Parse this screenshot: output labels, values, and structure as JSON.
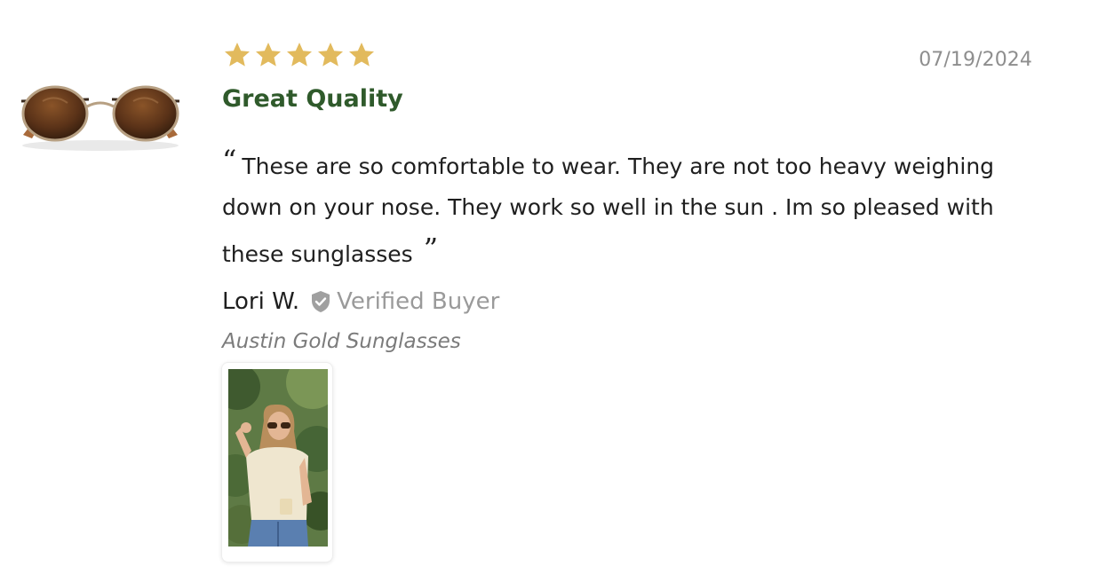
{
  "review": {
    "rating": 5,
    "rating_max": 5,
    "date": "07/19/2024",
    "title": "Great Quality",
    "body": "These are so comfortable to wear. They are not too heavy weighing down on your nose. They work so well in the sun . Im so pleased with these sunglasses",
    "quote_open": "“",
    "quote_close": "”",
    "author": "Lori W.",
    "verified_label": "Verified Buyer",
    "product_name": "Austin Gold Sunglasses"
  },
  "icons": {
    "star": "star-icon",
    "verified": "shield-check-icon"
  },
  "colors": {
    "star": "#e2ba5d",
    "title": "#2f5a2b",
    "verified_badge": "#a0a0a0",
    "muted_text": "#8e8e8e"
  }
}
